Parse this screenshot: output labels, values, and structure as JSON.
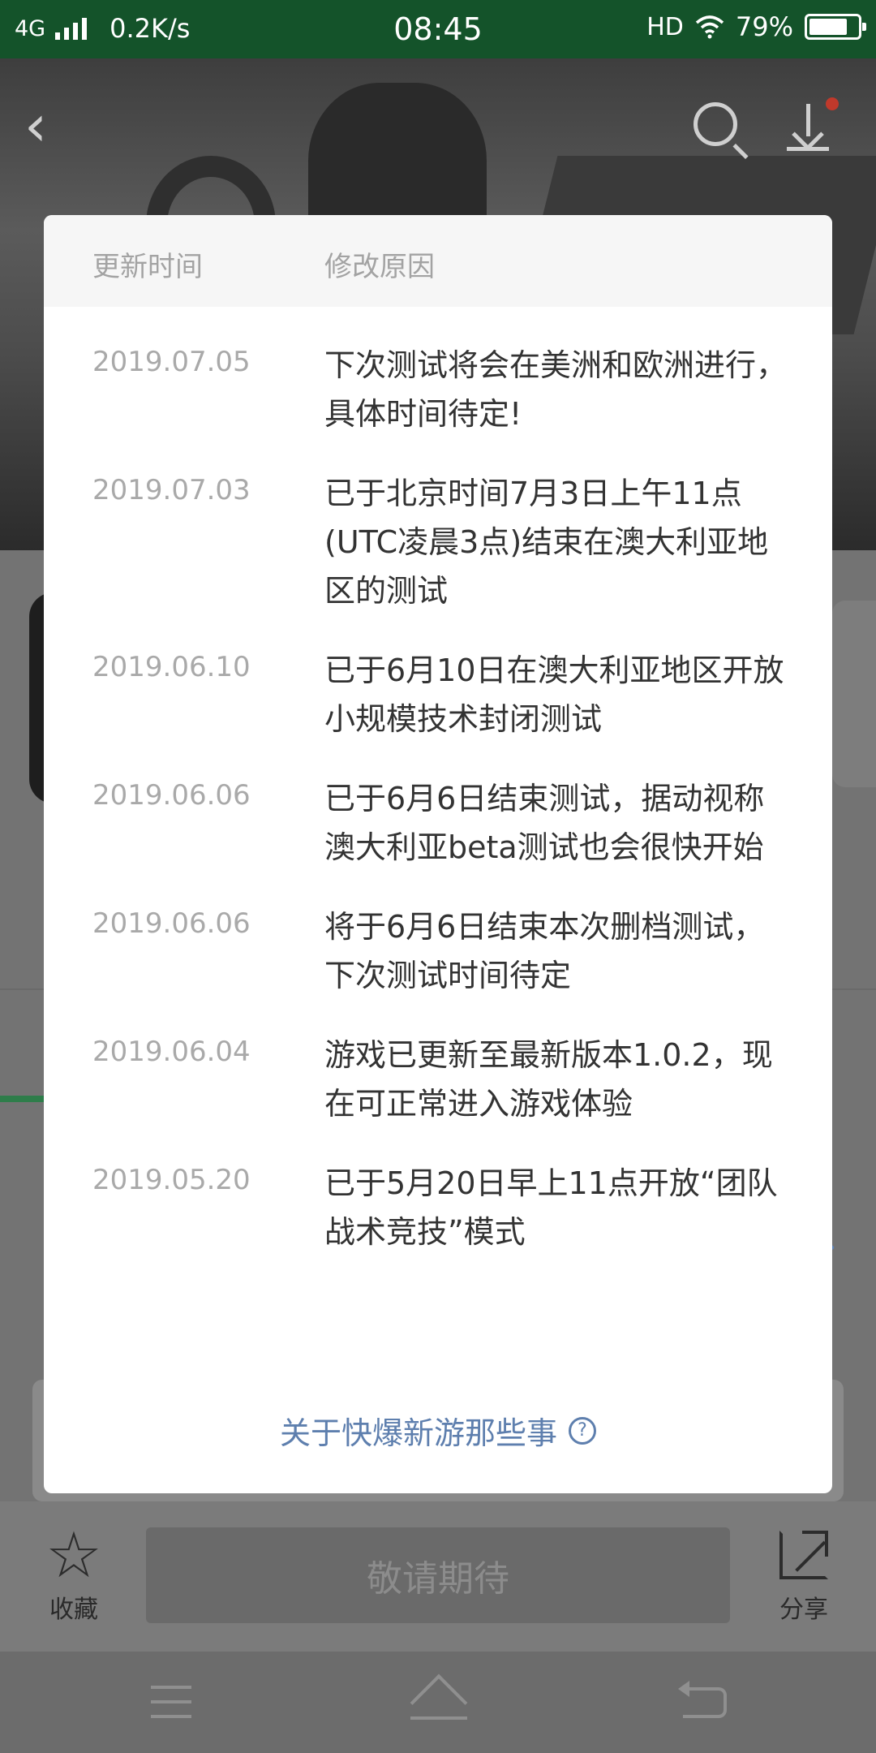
{
  "status_bar": {
    "network": "4G",
    "speed": "0.2K/s",
    "time": "08:45",
    "hd": "HD",
    "battery": "79%",
    "battery_level": 0.79
  },
  "bottom_bar": {
    "favorite_label": "收藏",
    "cta_label": "敬请期待",
    "share_label": "分享"
  },
  "modal": {
    "header": {
      "date_col": "更新时间",
      "reason_col": "修改原因"
    },
    "entries": [
      {
        "date": "2019.07.05",
        "reason": "下次测试将会在美洲和欧洲进行，具体时间待定!"
      },
      {
        "date": "2019.07.03",
        "reason": "已于北京时间7月3日上午11点(UTC凌晨3点)结束在澳大利亚地区的测试"
      },
      {
        "date": "2019.06.10",
        "reason": "已于6月10日在澳大利亚地区开放小规模技术封闭测试"
      },
      {
        "date": "2019.06.06",
        "reason": "已于6月6日结束测试，据动视称澳大利亚beta测试也会很快开始"
      },
      {
        "date": "2019.06.06",
        "reason": "将于6月6日结束本次删档测试，下次测试时间待定"
      },
      {
        "date": "2019.06.04",
        "reason": "游戏已更新至最新版本1.0.2，现在可正常进入游戏体验"
      },
      {
        "date": "2019.05.20",
        "reason": "已于5月20日早上11点开放“团队战术竞技”模式"
      }
    ],
    "footer_link": "关于快爆新游那些事",
    "help_glyph": "?"
  },
  "colors": {
    "status_bar_bg": "#14532a",
    "link": "#5e7fae",
    "accent_green": "#2e7d4a"
  }
}
